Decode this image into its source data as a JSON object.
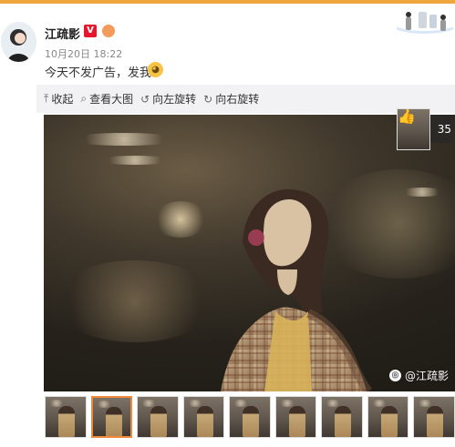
{
  "header": {
    "username": "江疏影",
    "verified_badge": "V",
    "post_time": "10月20日 18:22",
    "post_text": "今天不发广告，发我"
  },
  "toolbar": {
    "items": [
      {
        "icon": "collapse-icon",
        "label": "收起"
      },
      {
        "icon": "zoom-in-icon",
        "label": "查看大图"
      },
      {
        "icon": "rotate-left-icon",
        "label": "向左旋转"
      },
      {
        "icon": "rotate-right-icon",
        "label": "向右旋转"
      }
    ]
  },
  "photo": {
    "like_count": "35",
    "watermark_text": "@江疏影"
  },
  "thumbnails": {
    "count": 9,
    "selected_index": 1
  },
  "colors": {
    "accent_orange": "#f0a73e",
    "selected_border": "#f08a3a",
    "toolbar_bg": "#f2f2f5",
    "verified_red": "#e6162d"
  }
}
